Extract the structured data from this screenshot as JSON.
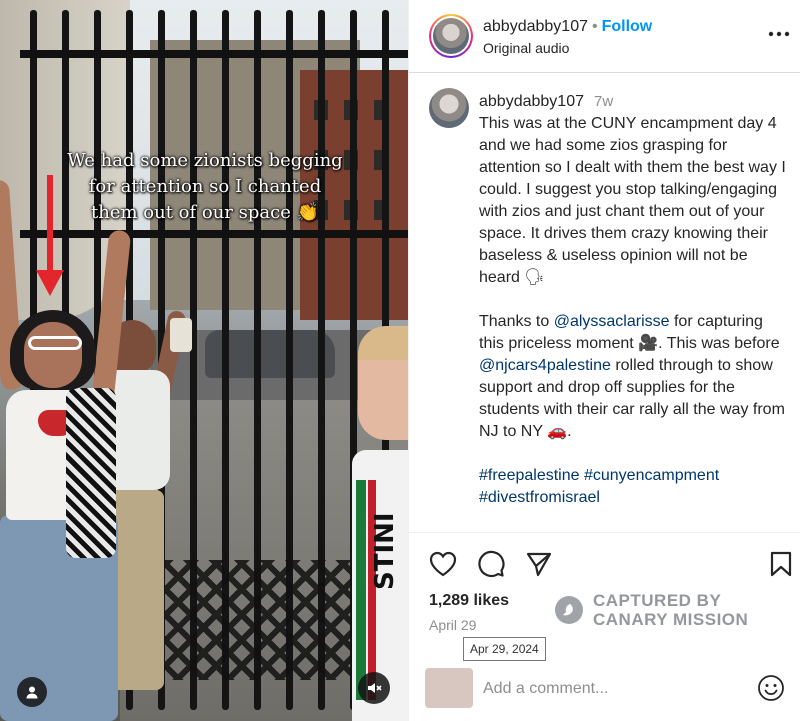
{
  "video": {
    "caption_lines": [
      "We had some zionists begging",
      "for attention so I chanted",
      "them out of our space 👏"
    ],
    "shirt_text": "STINI"
  },
  "header": {
    "username": "abbydabby107",
    "separator": "•",
    "follow_label": "Follow",
    "audio": "Original audio"
  },
  "comment": {
    "username": "abbydabby107",
    "time": "7w",
    "text_1": "This was at the CUNY encampment day 4 and we had some zios grasping for attention so I dealt with them the best way I could. I suggest you stop talking/engaging with zios and just chant them out of your space. It drives them crazy knowing their baseless & useless opinion will not be heard 🗣",
    "text_2a": "Thanks to ",
    "mention_1": "@alyssaclarisse",
    "text_2b": " for capturing this priceless moment 🎥. This was before ",
    "mention_2": "@njcars4palestine",
    "text_2c": " rolled through to show support and drop off supplies for the students with their car rally all the way from NJ to NY 🚗.",
    "hashtag_1": "#freepalestine",
    "hashtag_2": "#cunyencampment",
    "hashtag_3": "#divestfromisrael"
  },
  "post": {
    "likes": "1,289 likes",
    "date": "April 29",
    "date_tooltip": "Apr 29, 2024"
  },
  "watermark": {
    "line_1": "CAPTURED BY",
    "line_2": "CANARY MISSION"
  },
  "add_comment": {
    "placeholder": "Add a comment..."
  },
  "colors": {
    "follow": "#0095f6",
    "link": "#00376b",
    "arrow": "#e3262b"
  },
  "icons": [
    "heart-icon",
    "comment-icon",
    "share-icon",
    "bookmark-icon",
    "more-icon",
    "user-tag-icon",
    "mute-icon",
    "emoji-icon"
  ]
}
